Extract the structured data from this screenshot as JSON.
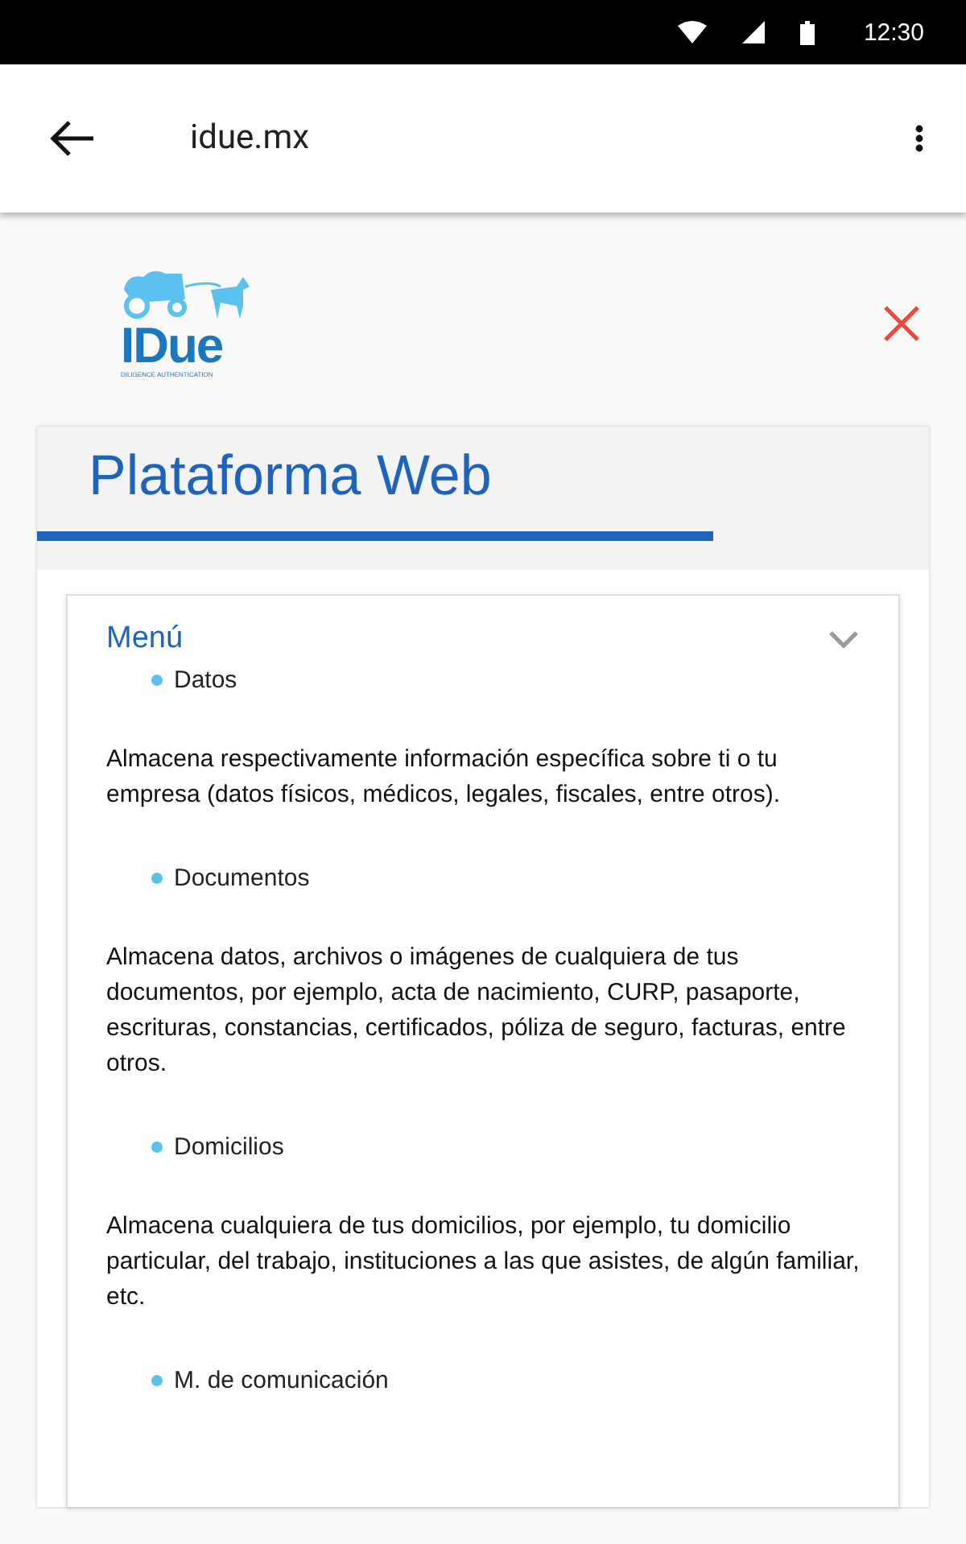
{
  "status_bar": {
    "time": "12:30"
  },
  "app_bar": {
    "title": "idue.mx"
  },
  "logo": {
    "name": "IDue",
    "tagline": "DILIGENCE AUTHENTICATION"
  },
  "panel": {
    "title": "Plataforma Web"
  },
  "menu": {
    "title": "Menú",
    "expanded": true,
    "items": [
      {
        "label": "Datos",
        "description": "Almacena respectivamente información específica sobre ti o tu empresa (datos físicos, médicos, legales, fiscales, entre otros)."
      },
      {
        "label": "Documentos",
        "description": "Almacena datos, archivos o imágenes de cualquiera de tus documentos, por ejemplo, acta de nacimiento, CURP, pasaporte, escrituras, constancias, certificados, póliza de seguro, facturas, entre otros."
      },
      {
        "label": "Domicilios",
        "description": "Almacena cualquiera de tus domicilios, por ejemplo, tu domicilio particular, del trabajo, instituciones a las que asistes, de algún familiar, etc."
      },
      {
        "label": "M. de comunicación"
      }
    ]
  }
}
